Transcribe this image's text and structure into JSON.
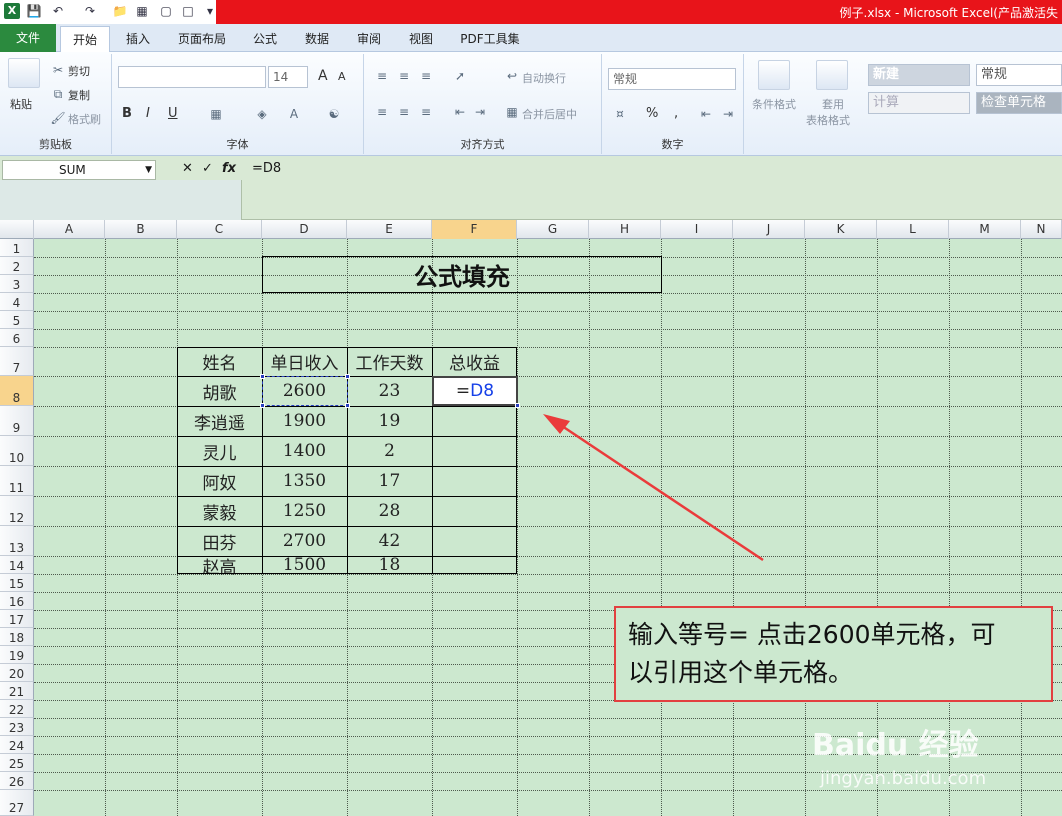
{
  "window": {
    "title": "例子.xlsx  -  Microsoft Excel(产品激活失"
  },
  "tabs": [
    "文件",
    "开始",
    "插入",
    "页面布局",
    "公式",
    "数据",
    "审阅",
    "视图",
    "PDF工具集"
  ],
  "ribbon": {
    "clipboard": {
      "paste": "粘贴",
      "cut": "剪切",
      "copy": "复制",
      "format_painter": "格式刷",
      "label": "剪贴板"
    },
    "font": {
      "font_size": "14",
      "bold": "B",
      "italic": "I",
      "underline": "U",
      "grow": "A",
      "shrink": "A",
      "label": "字体"
    },
    "alignment": {
      "wrap": "自动换行",
      "merge": "合并后居中",
      "label": "对齐方式"
    },
    "number": {
      "format": "常规",
      "percent": "%",
      "comma": ",",
      "label": "数字"
    },
    "styles": {
      "conditional": "条件格式",
      "table_format_1": "套用",
      "table_format_2": "表格格式",
      "new": "新建",
      "normal": "常规",
      "calc": "计算",
      "check": "检查单元格"
    }
  },
  "formula_bar": {
    "name_box": "SUM",
    "cancel": "✕",
    "enter": "✓",
    "fx": "fx",
    "formula": "=D8"
  },
  "columns": [
    "A",
    "B",
    "C",
    "D",
    "E",
    "F",
    "G",
    "H",
    "I",
    "J",
    "K",
    "L",
    "M",
    "N"
  ],
  "rows": [
    "1",
    "2",
    "3",
    "4",
    "5",
    "6",
    "7",
    "8",
    "9",
    "10",
    "11",
    "12",
    "13",
    "14",
    "15",
    "16",
    "17",
    "18",
    "19",
    "20",
    "21",
    "22",
    "23",
    "24",
    "25",
    "26",
    "27"
  ],
  "sheet": {
    "title": "公式填充",
    "headers": [
      "姓名",
      "单日收入",
      "工作天数",
      "总收益"
    ],
    "records": [
      [
        "胡歌",
        "2600",
        "23"
      ],
      [
        "李逍遥",
        "1900",
        "19"
      ],
      [
        "灵儿",
        "1400",
        "2"
      ],
      [
        "阿奴",
        "1350",
        "17"
      ],
      [
        "蒙毅",
        "1250",
        "28"
      ],
      [
        "田芬",
        "2700",
        "42"
      ],
      [
        "赵高",
        "1500",
        "18"
      ]
    ],
    "active_cell": {
      "eq": "=",
      "ref": "D8"
    }
  },
  "callout": {
    "line1": "输入等号= 点击2600单元格，可",
    "line2": "以引用这个单元格。"
  },
  "watermark": {
    "brand": "Baidu 经验",
    "url": "jingyan.baidu.com"
  },
  "colors": {
    "grid_bg": "#cce8cf",
    "titlebar": "#e8141a",
    "file_tab": "#2b8a3e",
    "ref_blue": "#1640e8",
    "callout_border": "#e24040"
  }
}
